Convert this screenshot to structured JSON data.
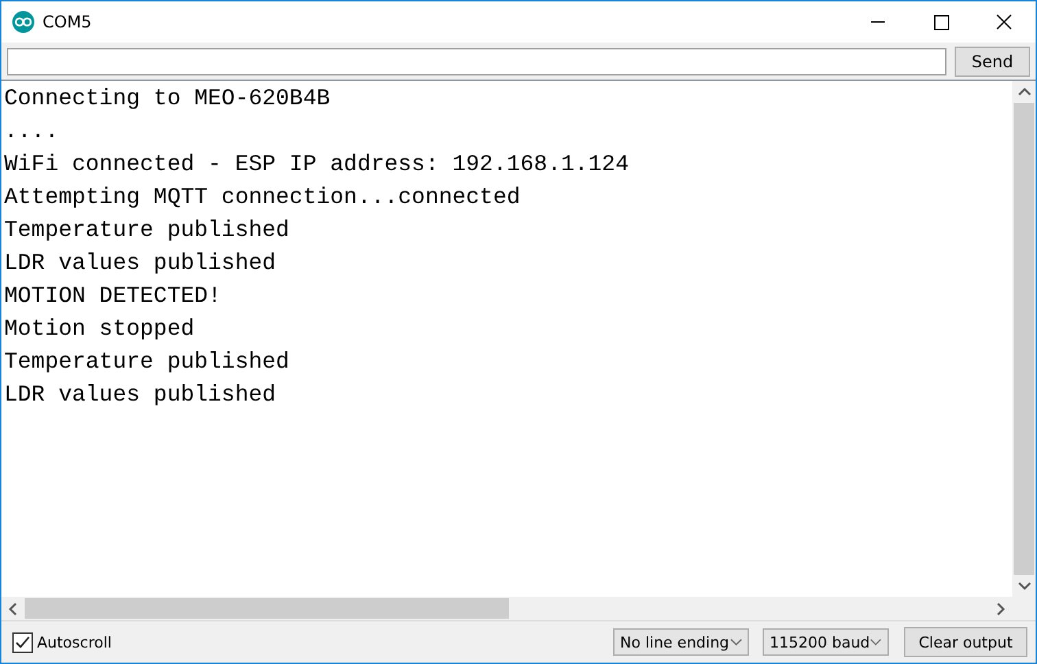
{
  "window": {
    "title": "COM5"
  },
  "send_button": "Send",
  "output_lines": [
    "Connecting to MEO-620B4B",
    "....",
    "WiFi connected - ESP IP address: 192.168.1.124",
    "Attempting MQTT connection...connected",
    "Temperature published",
    "LDR values published",
    "MOTION DETECTED!",
    "Motion stopped",
    "Temperature published",
    "LDR values published"
  ],
  "autoscroll": {
    "label": "Autoscroll",
    "checked": true
  },
  "line_ending": "No line ending",
  "baud_rate": "115200 baud",
  "clear_button": "Clear output"
}
